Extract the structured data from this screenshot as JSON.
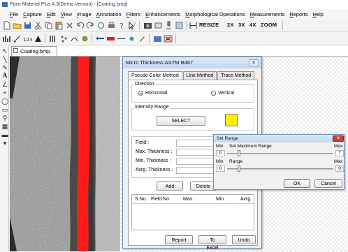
{
  "window": {
    "title": "Pace Material Plus 4.3(Demo Version) - [Coating.bmp]"
  },
  "menu": [
    "File",
    "Capture",
    "Edit",
    "View",
    "Image",
    "Annotation",
    "Filters",
    "Enhancements",
    "Morphological Operations",
    "Measurements",
    "Reports",
    "Help"
  ],
  "toolbar": {
    "resize_label": "RESIZE",
    "zoom_2x": "2X",
    "zoom_3x": "3X",
    "zoom_4x": "4X",
    "zoom_label": "ZOOM"
  },
  "document": {
    "tab_label": "Coating.bmp"
  },
  "colors": {
    "highlight": "#ff1a1a",
    "swatch": "#ffee00",
    "accent": "#1d5fbf"
  },
  "dialog": {
    "title": "Micro Thickness ASTM B487",
    "tabs": [
      "Pseudo Color Method",
      "Line Method",
      "Trace Method"
    ],
    "direction_label": "Direction",
    "horizontal_label": "Horizontal",
    "vertical_label": "Vertical",
    "intensity_label": "Intensity Range",
    "select_label": "SELECT",
    "field_label": "Field :",
    "max_label": "Max. Thickness :",
    "min_label": "Min. Thickness :",
    "avg_label": "Avrg. Thickness :",
    "add_label": "Add",
    "delete_label": "Delete",
    "columns": [
      "S.No.",
      "Field No",
      "Max.",
      "Min.",
      "Avrg."
    ],
    "report_label": "Report",
    "excel_label": "To Excel",
    "undo_label": "Undo"
  },
  "set_range": {
    "title": "Set Range",
    "max_row_min_label": "Min",
    "max_row_title": "Set Maximum Range",
    "max_row_max_label": "Max",
    "max_value_min": "0",
    "max_value_max": "7",
    "min_row_min_label": "Min",
    "min_row_title": "Range",
    "min_row_max_label": "Max",
    "min_value_min": "0",
    "min_value_max": "0",
    "ok_label": "OK",
    "cancel_label": "Cancel"
  }
}
